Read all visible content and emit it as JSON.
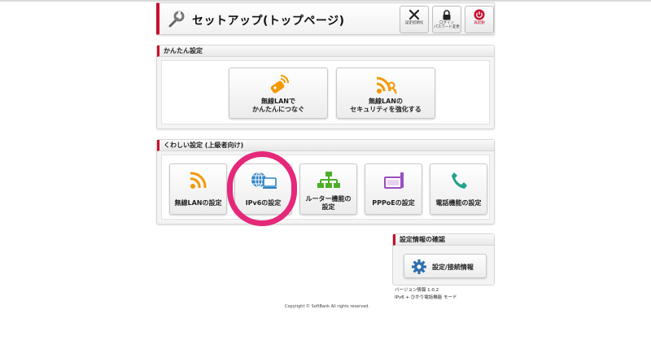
{
  "header": {
    "title": "セットアップ(トップページ)",
    "buttons": [
      {
        "icon": "tools-icon",
        "label": "設定初期化"
      },
      {
        "icon": "lock-icon",
        "label": "ログイン\nパスワード変更"
      },
      {
        "icon": "power-icon",
        "label": "再起動"
      }
    ]
  },
  "simple_settings": {
    "title": "かんたん設定",
    "tiles": [
      {
        "icon": "wireless-key-icon",
        "label": "無線LANで\nかんたんにつなぐ"
      },
      {
        "icon": "wireless-security-icon",
        "label": "無線LANの\nセキュリティを強化する"
      }
    ]
  },
  "advanced_settings": {
    "title": "くわしい設定 (上級者向け)",
    "tiles": [
      {
        "icon": "wifi-icon",
        "label": "無線LANの設定"
      },
      {
        "icon": "globe-computer-icon",
        "label": "IPv6の設定"
      },
      {
        "icon": "network-tree-icon",
        "label": "ルーター機能の\n設定"
      },
      {
        "icon": "router-icon",
        "label": "PPPoEの設定"
      },
      {
        "icon": "phone-icon",
        "label": "電話機能の設定"
      }
    ]
  },
  "confirm": {
    "title": "設定情報の確認",
    "button_label": "設定/接続情報"
  },
  "version_info": "バージョン情報 1.0.2\nIPv6 + ひかり電話機能 モード",
  "copyright": "Copyright © SoftBank All rights reserved.",
  "colors": {
    "accent": "#c8102e",
    "orange": "#f39800",
    "blue": "#2e83c5",
    "green": "#4caf27",
    "purple": "#9a4fc0",
    "teal": "#22a28a",
    "highlight": "#e5287a"
  }
}
